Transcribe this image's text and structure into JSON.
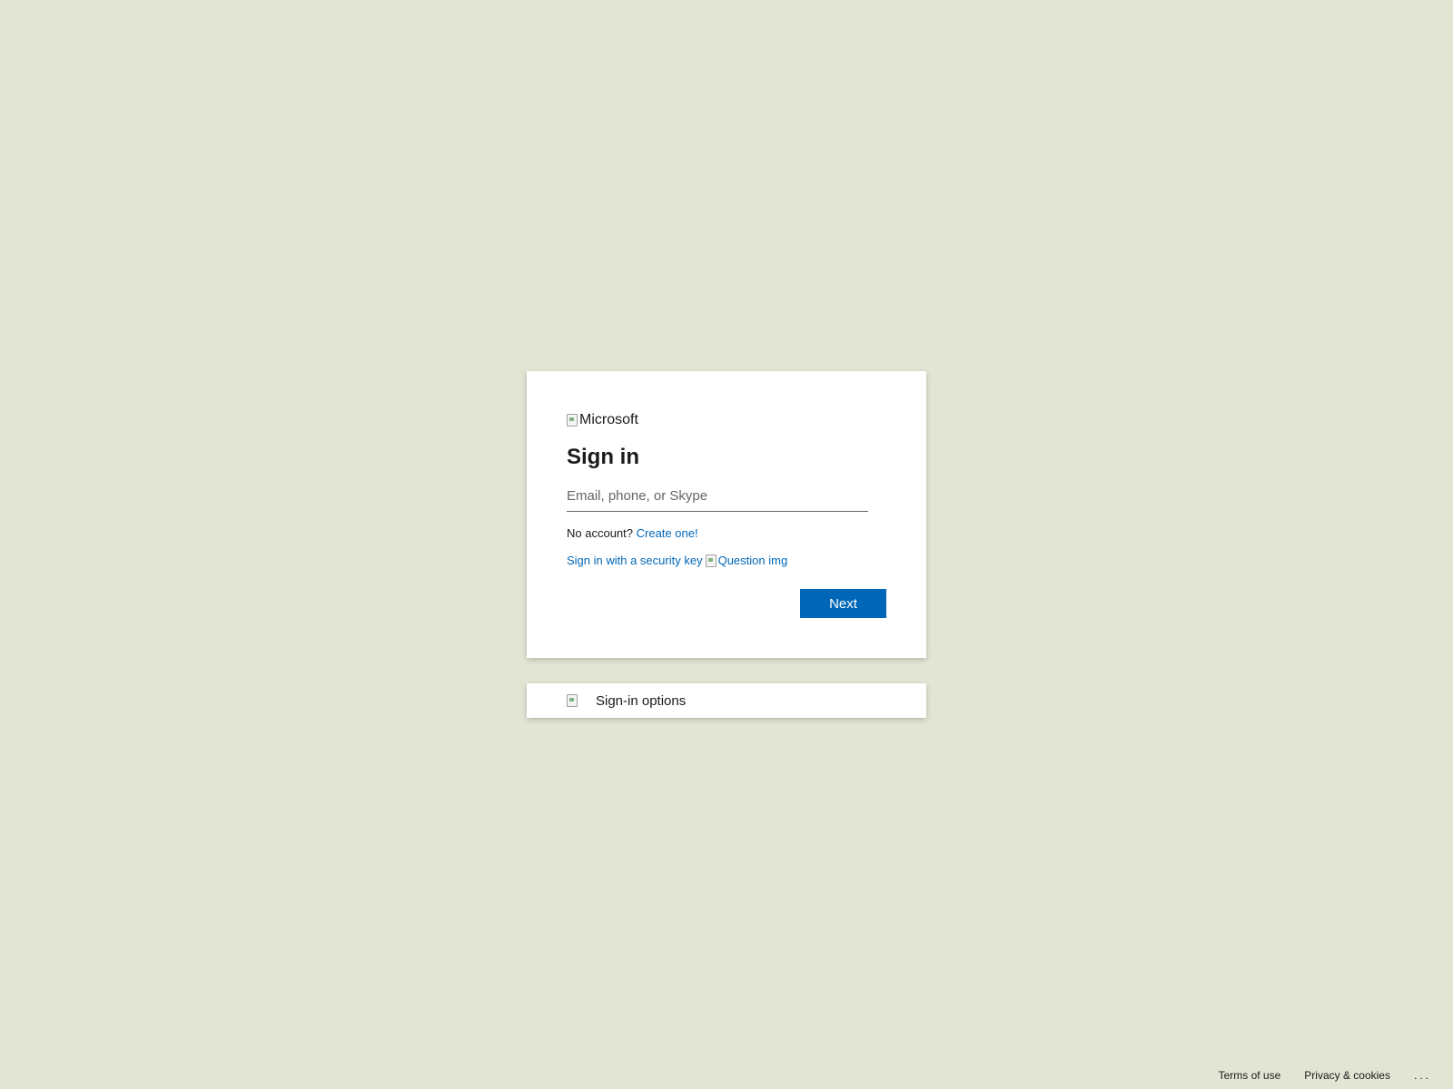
{
  "logo": {
    "alt_text": "Microsoft"
  },
  "signin": {
    "title": "Sign in",
    "input_placeholder": "Email, phone, or Skype",
    "input_value": "",
    "no_account_text": "No account?",
    "create_link": "Create one!",
    "security_key_link": "Sign in with a security key",
    "question_img_alt": "Question img",
    "next_button": "Next"
  },
  "options": {
    "label": "Sign-in options"
  },
  "footer": {
    "terms": "Terms of use",
    "privacy": "Privacy & cookies",
    "more": "..."
  },
  "colors": {
    "background": "#e2e5d4",
    "accent": "#0067b8",
    "text": "#1b1b1b"
  }
}
